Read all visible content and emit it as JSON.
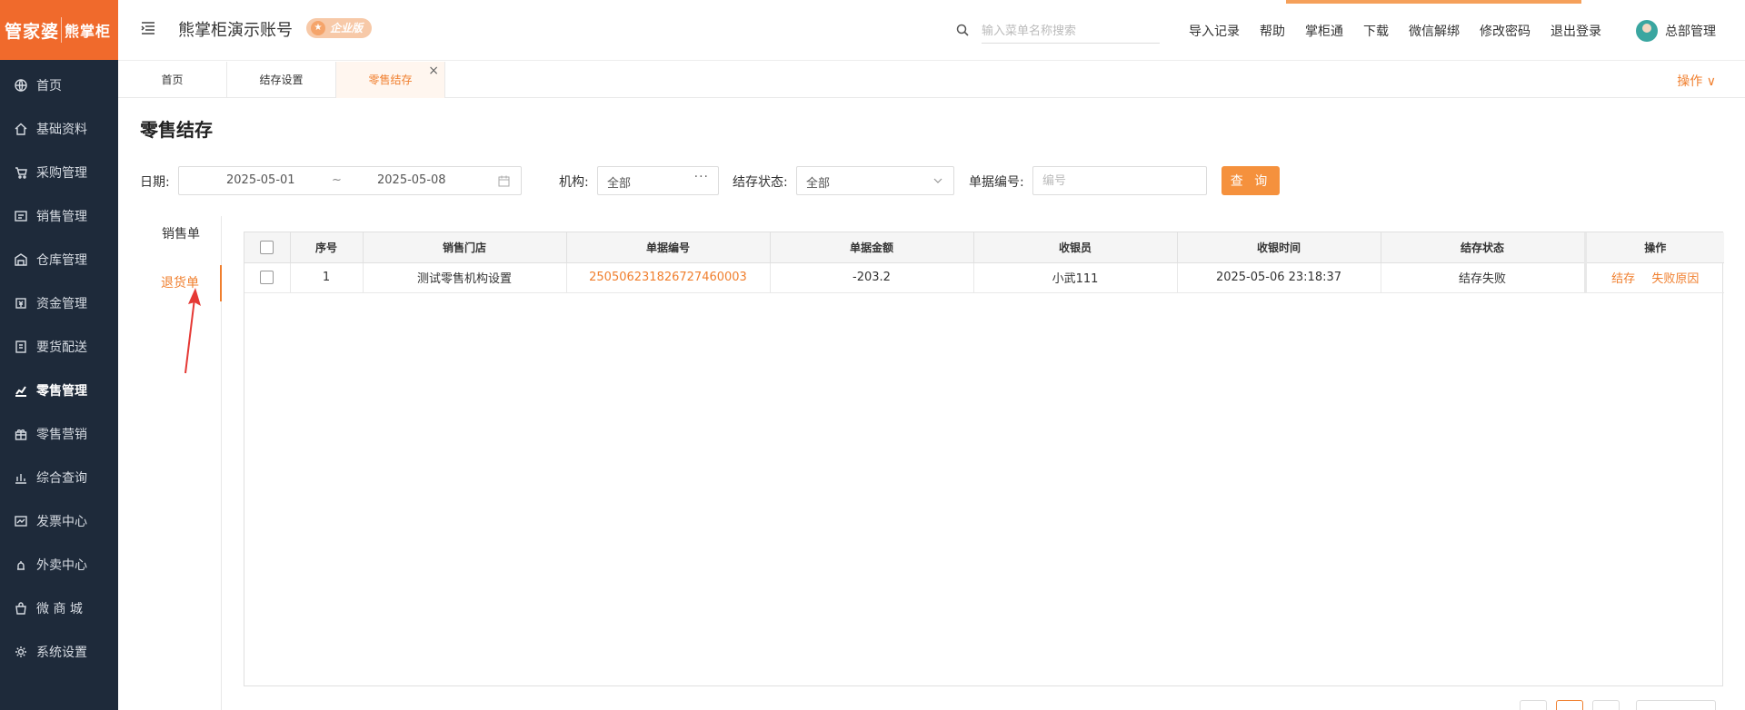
{
  "brand": {
    "logo_a": "管家婆",
    "logo_b": "熊掌柜",
    "color": "#f06a2c"
  },
  "sidebar": {
    "items": [
      {
        "label": "首页",
        "icon": "globe-icon"
      },
      {
        "label": "基础资料",
        "icon": "home-icon"
      },
      {
        "label": "采购管理",
        "icon": "cart-icon"
      },
      {
        "label": "销售管理",
        "icon": "sales-icon"
      },
      {
        "label": "仓库管理",
        "icon": "warehouse-icon"
      },
      {
        "label": "资金管理",
        "icon": "money-icon"
      },
      {
        "label": "要货配送",
        "icon": "document-icon"
      },
      {
        "label": "零售管理",
        "icon": "chart-icon"
      },
      {
        "label": "零售营销",
        "icon": "gift-icon"
      },
      {
        "label": "综合查询",
        "icon": "bar-chart-icon"
      },
      {
        "label": "发票中心",
        "icon": "invoice-icon"
      },
      {
        "label": "外卖中心",
        "icon": "delivery-icon"
      },
      {
        "label": "微 商 城",
        "icon": "shop-icon"
      },
      {
        "label": "系统设置",
        "icon": "gear-icon"
      }
    ],
    "active_index": 7
  },
  "header": {
    "account": "熊掌柜演示账号",
    "edition_badge": "企业版",
    "search_placeholder": "输入菜单名称搜索",
    "links": [
      "导入记录",
      "帮助",
      "掌柜通",
      "下载",
      "微信解绑",
      "修改密码",
      "退出登录"
    ],
    "user": "总部管理"
  },
  "tabs": {
    "items": [
      "首页",
      "结存设置",
      "零售结存"
    ],
    "active_index": 2,
    "close": "×",
    "ops_label": "操作 ∨"
  },
  "page": {
    "title": "零售结存"
  },
  "filters": {
    "date_label": "日期:",
    "date_start": "2025-05-01",
    "date_sep": "~",
    "date_end": "2025-05-08",
    "org_label": "机构:",
    "org_value": "全部",
    "org_dots": "···",
    "status_label": "结存状态:",
    "status_value": "全部",
    "billno_label": "单据编号:",
    "billno_placeholder": "编号",
    "query_button": "查 询"
  },
  "subtabs": {
    "items": [
      "销售单",
      "退货单"
    ],
    "active_index": 1
  },
  "table": {
    "columns": [
      "序号",
      "销售门店",
      "单据编号",
      "单据金额",
      "收银员",
      "收银时间",
      "结存状态",
      "操作"
    ],
    "rows": [
      {
        "index": "1",
        "store": "测试零售机构设置",
        "bill_no": "250506231826727460003",
        "amount": "-203.2",
        "cashier": "小武111",
        "time": "2025-05-06 23:18:37",
        "status": "结存失败",
        "op1": "结存",
        "op2": "失败原因"
      }
    ]
  },
  "colors": {
    "accent": "#f07f2e",
    "sidebar_bg": "#1e2a3a"
  }
}
